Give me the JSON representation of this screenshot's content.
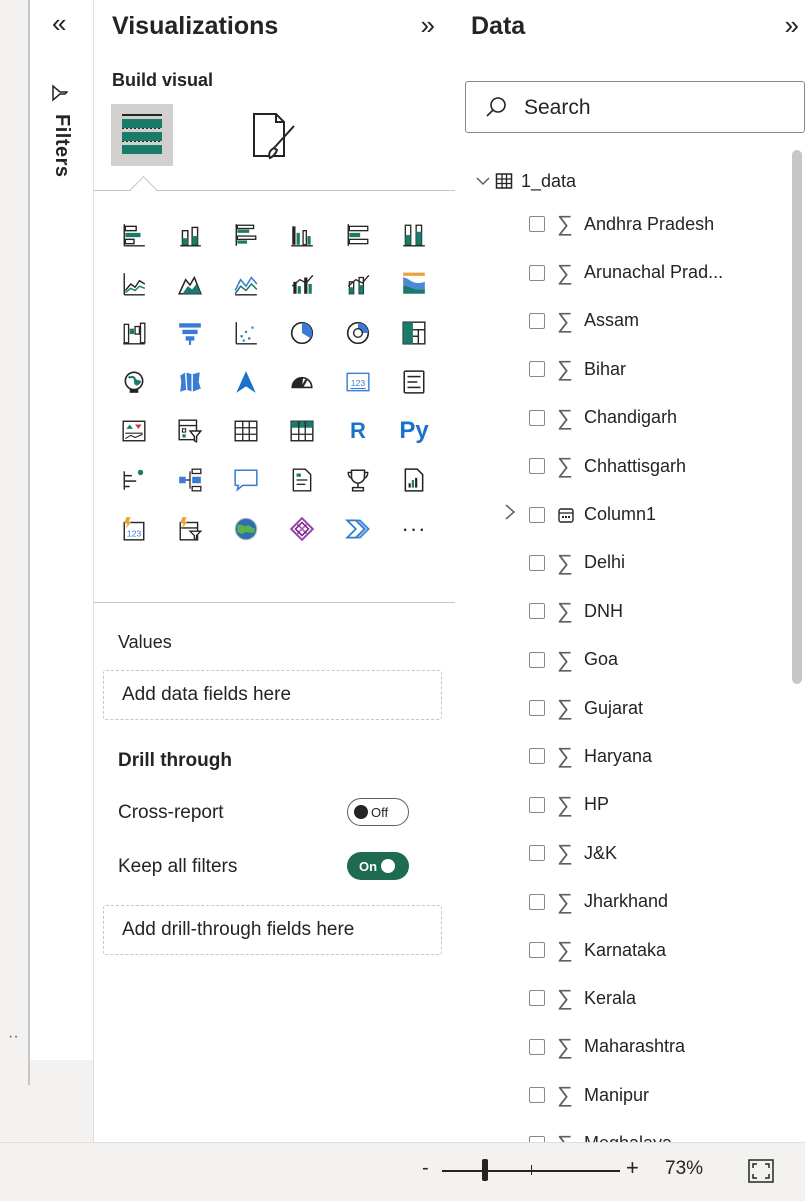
{
  "filters": {
    "label": "Filters",
    "collapse_icon": "double-chevron-left-icon",
    "funnel_icon": "filter-icon",
    "dots": "··"
  },
  "visualizations": {
    "title": "Visualizations",
    "build_visual_label": "Build visual",
    "expand_icon": "double-chevron-right-icon",
    "gallery_icons": [
      "stacked-bar-chart",
      "stacked-column-chart",
      "clustered-bar-chart",
      "clustered-column-chart",
      "100-stacked-bar-chart",
      "100-stacked-column-chart",
      "line-chart",
      "area-chart",
      "stacked-area-chart",
      "line-clustered-column-chart",
      "line-stacked-column-chart",
      "ribbon-chart",
      "waterfall-chart",
      "funnel-chart",
      "scatter-chart",
      "pie-chart",
      "donut-chart",
      "treemap",
      "map",
      "filled-map",
      "azure-map",
      "gauge",
      "card",
      "multi-row-card",
      "kpi",
      "slicer",
      "table",
      "matrix",
      "r-visual",
      "python-visual",
      "key-influencers",
      "decomposition-tree",
      "qa",
      "smart-narrative",
      "goals",
      "paginated-report",
      "power-apps",
      "power-automate",
      "arcgis-map",
      "power-apps-visual",
      "power-automate-flow",
      "more-visuals"
    ],
    "r_text": "R",
    "py_text": "Py",
    "more_text": "···",
    "values_label": "Values",
    "values_placeholder": "Add data fields here",
    "drill_through_title": "Drill through",
    "cross_report_label": "Cross-report",
    "cross_report_toggle": "Off",
    "keep_filters_label": "Keep all filters",
    "keep_filters_toggle": "On",
    "drill_placeholder": "Add drill-through fields here"
  },
  "data": {
    "title": "Data",
    "expand_icon": "double-chevron-right-icon",
    "search_placeholder": "Search",
    "table_name": "1_data",
    "fields": [
      {
        "name": "Andhra Pradesh",
        "type": "sigma"
      },
      {
        "name": "Arunachal Prad...",
        "type": "sigma"
      },
      {
        "name": "Assam",
        "type": "sigma"
      },
      {
        "name": "Bihar",
        "type": "sigma"
      },
      {
        "name": "Chandigarh",
        "type": "sigma"
      },
      {
        "name": "Chhattisgarh",
        "type": "sigma"
      },
      {
        "name": "Column1",
        "type": "calendar",
        "expandable": true
      },
      {
        "name": "Delhi",
        "type": "sigma"
      },
      {
        "name": "DNH",
        "type": "sigma"
      },
      {
        "name": "Goa",
        "type": "sigma"
      },
      {
        "name": "Gujarat",
        "type": "sigma"
      },
      {
        "name": "Haryana",
        "type": "sigma"
      },
      {
        "name": "HP",
        "type": "sigma"
      },
      {
        "name": "J&K",
        "type": "sigma"
      },
      {
        "name": "Jharkhand",
        "type": "sigma"
      },
      {
        "name": "Karnataka",
        "type": "sigma"
      },
      {
        "name": "Kerala",
        "type": "sigma"
      },
      {
        "name": "Maharashtra",
        "type": "sigma"
      },
      {
        "name": "Manipur",
        "type": "sigma"
      },
      {
        "name": "Meghalaya",
        "type": "sigma"
      }
    ]
  },
  "status_bar": {
    "zoom_minus": "-",
    "zoom_plus": "+",
    "zoom_level": "73%",
    "zoom_fraction": 0.24,
    "fit_icon": "fit-to-page-icon"
  },
  "colors": {
    "accent_toggle": "#1e6b52",
    "selected_tab": "#d2d0ce",
    "teal_icon": "#1b7b6b"
  }
}
